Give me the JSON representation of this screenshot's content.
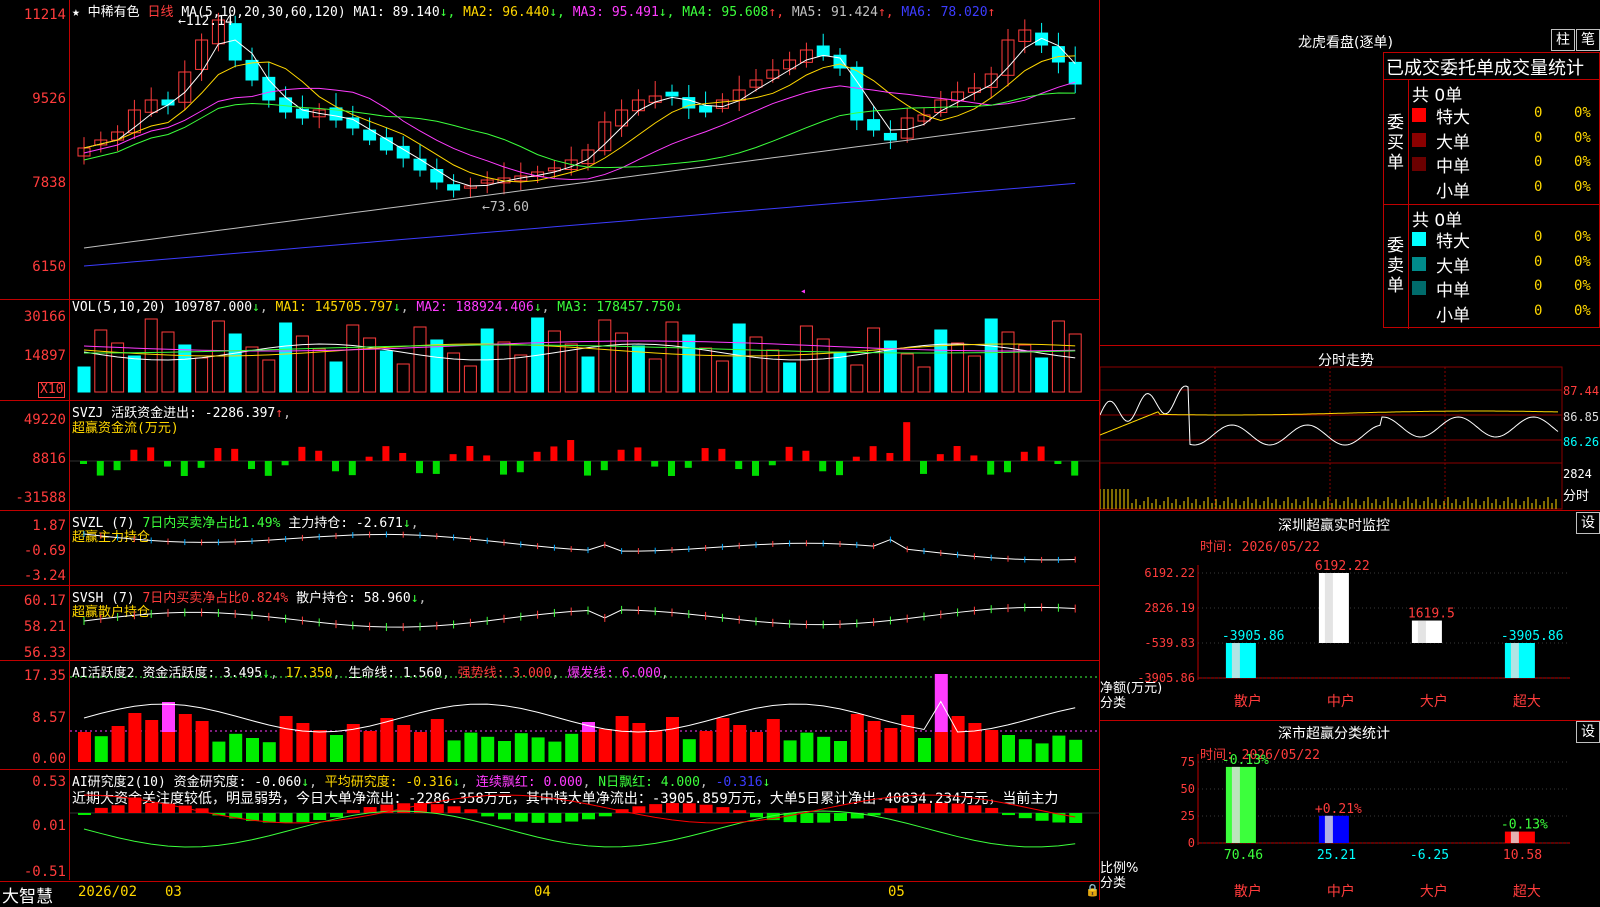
{
  "stock": {
    "star": "★",
    "name": "中稀有色",
    "period": "日线"
  },
  "main_pane": {
    "ma_title": "MA(5,10,20,30,60,120)",
    "ma": [
      {
        "label": "MA1: 89.140",
        "arrow": "↓",
        "color": "#ffffff"
      },
      {
        "label": "MA2: 96.440",
        "arrow": "↓",
        "color": "#ffd700"
      },
      {
        "label": "MA3: 95.491",
        "arrow": "↓",
        "color": "#ff3cff"
      },
      {
        "label": "MA4: 95.608",
        "arrow": "↑",
        "color": "#3cff3c"
      },
      {
        "label": "MA5: 91.424",
        "arrow": "↑",
        "color": "#c0c0c0"
      },
      {
        "label": "MA6: 78.020",
        "arrow": "↑",
        "color": "#3c3cff"
      }
    ],
    "y_ticks": [
      "11214",
      "9526",
      "7838",
      "6150"
    ],
    "high_mark": "112.14",
    "low_mark": "73.60"
  },
  "vol_pane": {
    "title": "VOL(5,10,20)",
    "vol": "109787.000",
    "ma1": "MA1: 145705.797",
    "ma2": "MA2: 188924.406",
    "ma3": "MA3: 178457.750",
    "arrow": "↓",
    "y_ticks": [
      "30166",
      "14897"
    ],
    "unit": "X10"
  },
  "svzj_pane": {
    "title": "SVZJ",
    "label": "活跃资金进出: -2286.397",
    "arrow": "↑",
    "sub": "超赢资金流(万元)",
    "y_ticks": [
      "49220",
      "8816",
      "-31588"
    ]
  },
  "svzl_pane": {
    "title": "SVZL (7)",
    "label1": "7日内买卖净占比1.49%",
    "label2": "主力持仓: -2.671",
    "arrow": "↓",
    "sub": "超赢主力持仓",
    "y_ticks": [
      "1.87",
      "-0.69",
      "-3.24"
    ]
  },
  "svsh_pane": {
    "title": "SVSH (7)",
    "label1": "7日内买卖净占比0.824%",
    "label2": "散户持仓: 58.960",
    "arrow": "↓",
    "sub": "超赢散户持仓",
    "y_ticks": [
      "60.17",
      "58.21",
      "56.33"
    ]
  },
  "ai_active_pane": {
    "title": "AI活跃度2",
    "label": "资金活跃度: 3.495",
    "v2": "17.350",
    "life": "生命线: 1.560",
    "strong": "强势线: 3.000",
    "burst": "爆发线: 6.000",
    "y_ticks": [
      "17.35",
      "8.57",
      "0.00"
    ]
  },
  "ai_research_pane": {
    "title": "AI研究度2(10)",
    "label": "资金研究度: -0.060",
    "avg": "平均研究度: -0.316",
    "streak": "连续飘红: 0.000",
    "nday": "N日飘红: 4.000",
    "last": "-0.316",
    "commentary": "近期大资金关注度较低，明显弱势，今日大单净流出：-2286.358万元，其中特大单净流出：-3905.859万元，大单5日累计净出-40834.234万元，当前主力",
    "y_ticks": [
      "0.53",
      "0.01",
      "-0.51"
    ]
  },
  "x_axis": {
    "brand": "大智慧",
    "labels": [
      "2026/02",
      "03",
      "04",
      "05"
    ]
  },
  "dragon_panel": {
    "title": "龙虎看盘(逐单)",
    "btn_a": "柱",
    "btn_b": "笔",
    "header": "已成交委托单成交量统计",
    "buy": {
      "side": "委买单",
      "total": "共 0单",
      "rows": [
        {
          "name": "特大",
          "count": "0",
          "pct": "0%",
          "color": "#ff0000"
        },
        {
          "name": "大单",
          "count": "0",
          "pct": "0%",
          "color": "#8b0000"
        },
        {
          "name": "中单",
          "count": "0",
          "pct": "0%",
          "color": "#6b0000"
        },
        {
          "name": "小单",
          "count": "0",
          "pct": "0%",
          "color": ""
        }
      ]
    },
    "sell": {
      "side": "委卖单",
      "total": "共 0单",
      "rows": [
        {
          "name": "特大",
          "count": "0",
          "pct": "0%",
          "color": "#00ffff"
        },
        {
          "name": "大单",
          "count": "0",
          "pct": "0%",
          "color": "#008b8b"
        },
        {
          "name": "中单",
          "count": "0",
          "pct": "0%",
          "color": "#006b6b"
        },
        {
          "name": "小单",
          "count": "0",
          "pct": "0%",
          "color": ""
        }
      ]
    }
  },
  "intraday_panel": {
    "title": "分时走势",
    "prices": [
      "87.44",
      "86.85",
      "86.26"
    ],
    "vol_label": "2824",
    "axis_label": "分时"
  },
  "sz_monitor": {
    "title": "深圳超赢实时监控",
    "settings": "设",
    "time": "时间: 2026/05/22",
    "y_ticks": [
      "6192.22",
      "2826.19",
      "-539.83",
      "-3905.86"
    ],
    "ylabel1": "净额(万元)",
    "ylabel2": "分类",
    "chart_data": {
      "type": "bar",
      "categories": [
        "散户",
        "中户",
        "大户",
        "超大"
      ],
      "values": [
        -3905.86,
        6192.22,
        1619.5,
        -3905.86
      ],
      "value_labels": [
        "-3905.86",
        "6192.22",
        "1619.5",
        "-3905.86"
      ],
      "ylim": [
        -3905.86,
        6192.22
      ]
    }
  },
  "sz_classify": {
    "title": "深市超赢分类统计",
    "settings": "设",
    "time": "时间: 2026/05/22",
    "y_ticks": [
      "75",
      "50",
      "25",
      "0"
    ],
    "ylabel1": "比例%",
    "ylabel2": "分类",
    "chart_data": {
      "type": "bar",
      "categories": [
        "散户",
        "中户",
        "大户",
        "超大"
      ],
      "values": [
        70.46,
        25.21,
        -6.25,
        10.58
      ],
      "changes": [
        "-0.13%",
        "+0.21%",
        "",
        "-0.13%"
      ],
      "value_labels": [
        "70.46",
        "25.21",
        "-6.25",
        "10.58"
      ],
      "ylim": [
        0,
        75
      ]
    }
  }
}
